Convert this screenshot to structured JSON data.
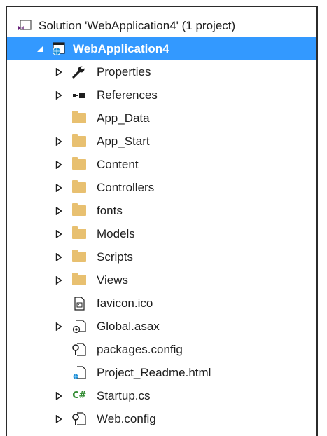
{
  "solution": {
    "label": "Solution 'WebApplication4' (1 project)",
    "icon": "solution-icon"
  },
  "project": {
    "label": "WebApplication4",
    "icon": "globe-project-icon",
    "accent": "#3399ff"
  },
  "items": [
    {
      "label": "Properties",
      "icon": "wrench-icon",
      "expandable": true
    },
    {
      "label": "References",
      "icon": "references-icon",
      "expandable": true
    },
    {
      "label": "App_Data",
      "icon": "folder-icon",
      "expandable": false
    },
    {
      "label": "App_Start",
      "icon": "folder-icon",
      "expandable": true
    },
    {
      "label": "Content",
      "icon": "folder-icon",
      "expandable": true
    },
    {
      "label": "Controllers",
      "icon": "folder-icon",
      "expandable": true
    },
    {
      "label": "fonts",
      "icon": "folder-icon",
      "expandable": true
    },
    {
      "label": "Models",
      "icon": "folder-icon",
      "expandable": true
    },
    {
      "label": "Scripts",
      "icon": "folder-icon",
      "expandable": true
    },
    {
      "label": "Views",
      "icon": "folder-icon",
      "expandable": true
    },
    {
      "label": "favicon.ico",
      "icon": "image-file-icon",
      "expandable": false
    },
    {
      "label": "Global.asax",
      "icon": "asax-file-icon",
      "expandable": true
    },
    {
      "label": "packages.config",
      "icon": "config-file-icon",
      "expandable": false
    },
    {
      "label": "Project_Readme.html",
      "icon": "html-file-icon",
      "expandable": false
    },
    {
      "label": "Startup.cs",
      "icon": "csharp-file-icon",
      "expandable": true
    },
    {
      "label": "Web.config",
      "icon": "config-file-icon",
      "expandable": true
    }
  ]
}
